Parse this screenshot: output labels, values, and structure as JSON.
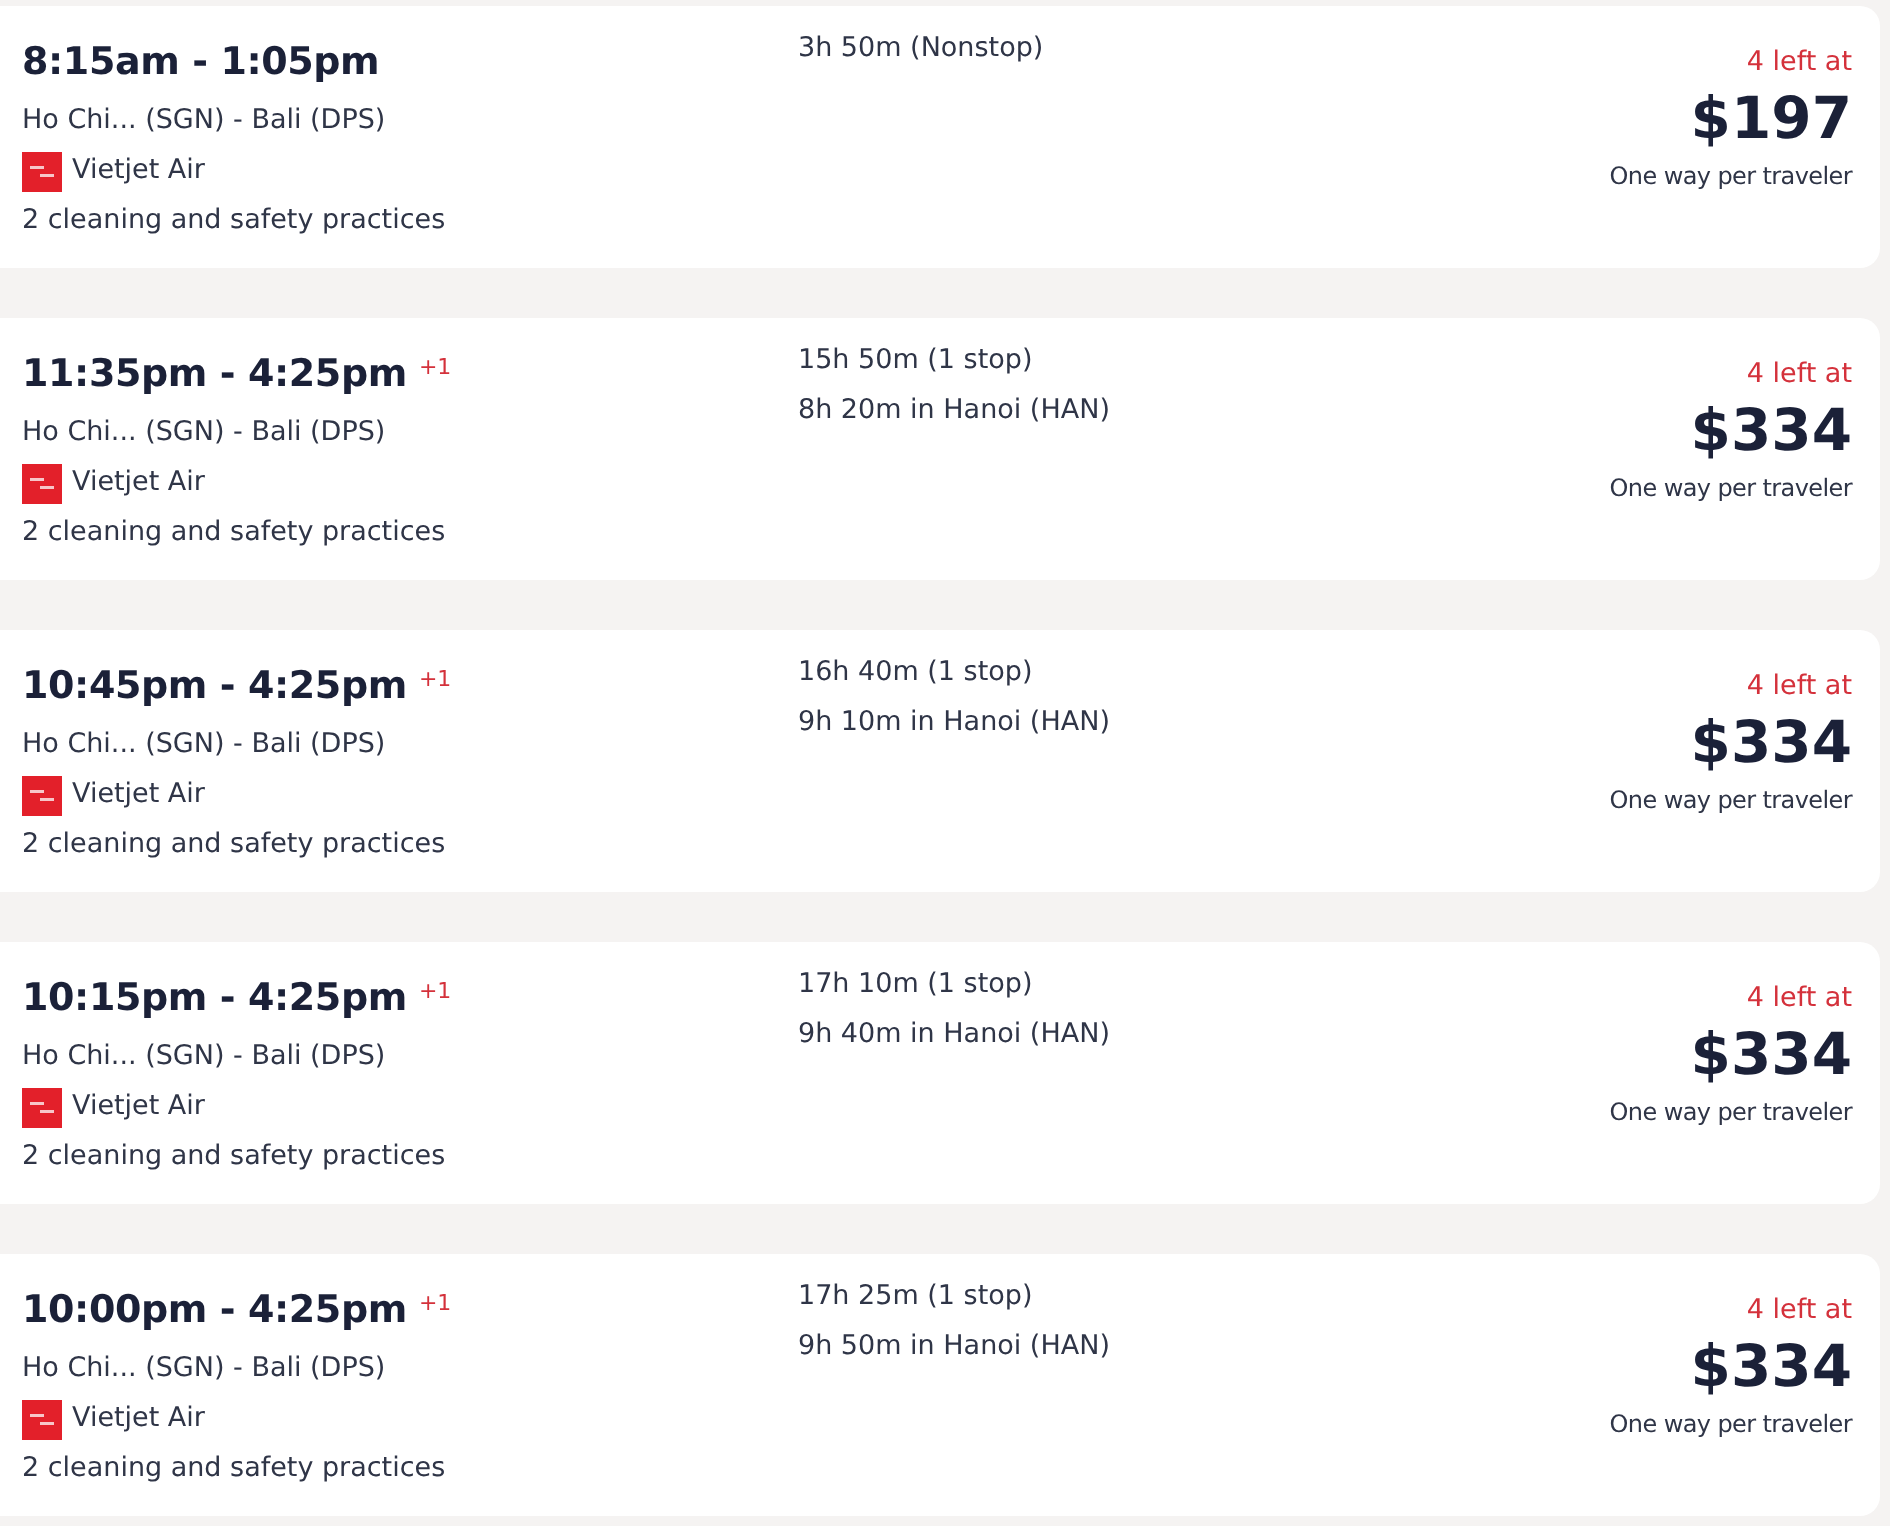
{
  "flights": [
    {
      "times": "8:15am - 1:05pm",
      "route": "Ho Chi... (SGN) - Bali (DPS)",
      "airline": "Vietjet Air",
      "practices": "2 cleaning and safety practices",
      "duration": "3h 50m (Nonstop)",
      "seats_left": "4 left at",
      "price": "$197",
      "price_note": "One way per traveler"
    },
    {
      "times": "11:35pm - 4:25pm",
      "day_offset": "+1",
      "route": "Ho Chi... (SGN) - Bali (DPS)",
      "airline": "Vietjet Air",
      "practices": "2 cleaning and safety practices",
      "duration": "15h 50m (1 stop)",
      "layover": "8h 20m in Hanoi (HAN)",
      "seats_left": "4 left at",
      "price": "$334",
      "price_note": "One way per traveler"
    },
    {
      "times": "10:45pm - 4:25pm",
      "day_offset": "+1",
      "route": "Ho Chi... (SGN) - Bali (DPS)",
      "airline": "Vietjet Air",
      "practices": "2 cleaning and safety practices",
      "duration": "16h 40m (1 stop)",
      "layover": "9h 10m in Hanoi (HAN)",
      "seats_left": "4 left at",
      "price": "$334",
      "price_note": "One way per traveler"
    },
    {
      "times": "10:15pm - 4:25pm",
      "day_offset": "+1",
      "route": "Ho Chi... (SGN) - Bali (DPS)",
      "airline": "Vietjet Air",
      "practices": "2 cleaning and safety practices",
      "duration": "17h 10m (1 stop)",
      "layover": "9h 40m in Hanoi (HAN)",
      "seats_left": "4 left at",
      "price": "$334",
      "price_note": "One way per traveler"
    },
    {
      "times": "10:00pm - 4:25pm",
      "day_offset": "+1",
      "route": "Ho Chi... (SGN) - Bali (DPS)",
      "airline": "Vietjet Air",
      "practices": "2 cleaning and safety practices",
      "duration": "17h 25m (1 stop)",
      "layover": "9h 50m in Hanoi (HAN)",
      "seats_left": "4 left at",
      "price": "$334",
      "price_note": "One way per traveler"
    }
  ]
}
